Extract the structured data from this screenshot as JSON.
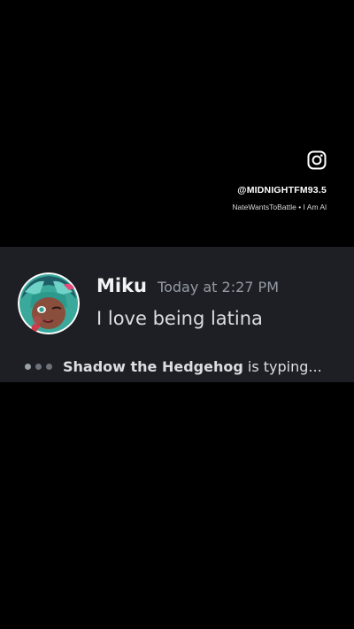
{
  "overlay": {
    "icon": "instagram-icon",
    "handle": "@MIDNIGHTFM93.5",
    "credit": "NateWantsToBattle • I Am Al"
  },
  "chat": {
    "message": {
      "username": "Miku",
      "timestamp": "Today at 2:27 PM",
      "text": "I love being latina"
    },
    "typing": {
      "name": "Shadow the Hedgehog",
      "suffix": " is typing..."
    }
  },
  "colors": {
    "background": "#000000",
    "panel": "#1e1f24",
    "username": "#f2f3f5",
    "timestamp": "#949ba4",
    "message_text": "#dbdee1"
  }
}
